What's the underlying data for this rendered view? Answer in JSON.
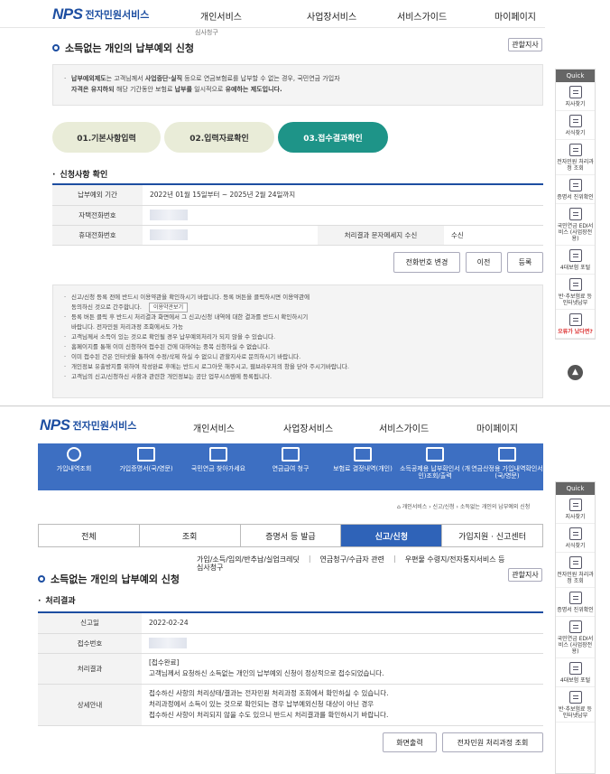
{
  "top": {
    "logo_mark": "NPS",
    "logo_text": "전자민원서비스",
    "nav": [
      "개인서비스",
      "사업장서비스",
      "서비스가이드",
      "마이페이지"
    ],
    "cut_sub": "심사청구",
    "page_title": "소득없는 개인의 납부예외 신청",
    "related_btn": "관할지사",
    "notice_lines": [
      {
        "pre": "",
        "bold1": "납부예외제도",
        "mid1": "는 고객님께서 ",
        "bold2": "사업중단·실직",
        "mid2": " 등으로 연금보험료를 납부할 수 없는 경우, 국민연금 가입자",
        "extra": ""
      },
      {
        "pre": "",
        "bold1": "자격은 유지하되 ",
        "mid1": "해당 기간동안 보험료 ",
        "bold2": "납부를",
        "mid2": " 일시적으로 ",
        "extra": "유예하는 제도입니다."
      }
    ],
    "steps": [
      "01.기본사항입력",
      "02.입력자료확인",
      "03.접수결과확인"
    ],
    "section": "신청사항 확인",
    "rows": {
      "period_label": "납부예외 기간",
      "period_value": "2022년 01월 15일부터 ~ 2025년 2월 24일까지",
      "home_label": "자택전화번호",
      "mobile_label": "휴대전화번호",
      "sms_label": "처리결과 문자메세지 수신",
      "sms_value": "수신"
    },
    "btn_phone": "전화번호 변경",
    "btn_prev": "이전",
    "btn_submit": "등록",
    "bullets": [
      "신고/신청 등록 전에 반드시 이용약관을 확인하시기 바랍니다. 등록 버튼을 클릭하시면 이용약관에",
      "동의하신 것으로 간주합니다.",
      "등록 버튼 클릭 후 반드시 처리결과 화면에서 그 신고/신청 내역에 대한 결과를 반드시 확인하시기",
      "바랍니다. 전자민원 처리과정 조회에서도 가능",
      "고객님께서 소득이 있는 것으로 확인될 경우 납부예외처리가 되지 않을 수 있습니다.",
      "홈페이지를 통해 이미 신청하여 접수된 건에 대하여는 중복 신청하실 수 없습니다.",
      "이미 접수된 건은 인터넷을 통하여 수정/삭제 하실 수 없으니 관할지사로 문의하시기 바랍니다.",
      "개인정보 유출방지를 위하여 작성완료 후에는 반드시 로그아웃 해주시고, 웹브라우저의 창을 닫아 주시기바랍니다.",
      "고객님의 신고/신청하신 사항과 관련한 개인정보는 공단 업무시스템에 등록됩니다."
    ],
    "terms_btn": "이용약관보기"
  },
  "quick": {
    "head": "Quick",
    "items": [
      "지사찾기",
      "서식찾기",
      "전자민원 처리과정 조회",
      "증명서 진위확인",
      "국민연금 EDI서비스 (사업장전용)",
      "4대보험 포털",
      "반·추보험료 등 인터넷납부",
      "오류가 났다면?"
    ]
  },
  "bottom": {
    "logo_mark": "NPS",
    "logo_text": "전자민원서비스",
    "nav": [
      "개인서비스",
      "사업장서비스",
      "서비스가이드",
      "마이페이지"
    ],
    "icons": [
      "가입내역조회",
      "가입증명서(국/영문)",
      "국민연금 찾아가세요",
      "연금급여 청구",
      "보험료 결정내역(개인)",
      "소득공제용 납부확인서 (개인)조회/출력",
      "연금산정용 가입내역확인서(국/영문)"
    ],
    "breadcrumb": "개인서비스 › 신고/신청 › 소득없는 개인의 납부예외 신청",
    "tabs": [
      "전체",
      "조회",
      "증명서 등 발급",
      "신고/신청",
      "가입지원 · 신고센터"
    ],
    "subs": [
      "가입/소득/임의/반추납/실업크레딧",
      "연금청구/수급자 관련",
      "우편물 수령지/전자통지서비스 등"
    ],
    "sub2": "심사청구",
    "page_title": "소득없는 개인의 납부예외 신청",
    "related_btn": "관할지사",
    "section": "처리결과",
    "report_label": "신고일",
    "report_value": "2022-02-24",
    "receipt_label": "접수번호",
    "result_label": "처리결과",
    "result_lines": [
      "[접수완료]",
      "고객님께서 요청하신 소득없는 개인의 납부예외 신청이 정상적으로 접수되었습니다."
    ],
    "detail_label": "상세안내",
    "detail_lines": [
      "접수하신 사항의 처리상태/결과는 전자민원 처리과정 조회에서 확인하실 수 있습니다.",
      "처리과정에서 소득이 있는 것으로 확인되는 경우 납부예외신청 대상이 아닌 경우",
      "접수하신 사항이 처리되지 않을 수도 있으니 반드시 처리결과를 확인하시기 바랍니다."
    ],
    "btn_print": "화면출력",
    "btn_track": "전자민원 처리과정 조회"
  },
  "colors": {
    "brand": "#1d4ea1",
    "accent": "#e8751a",
    "step_on": "#1e9488",
    "step_off": "#e9ecd8",
    "bar": "#3d6fc2"
  }
}
